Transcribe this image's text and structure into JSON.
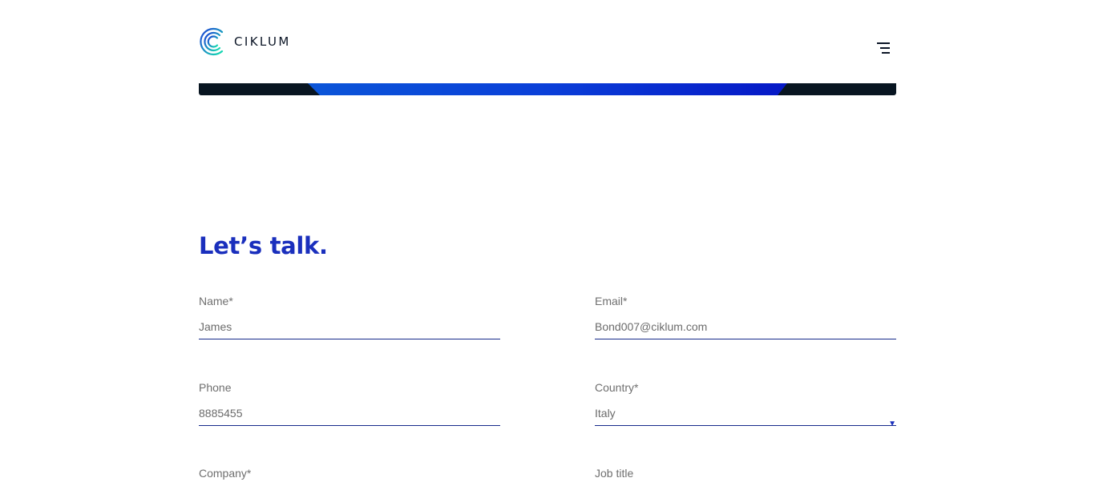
{
  "header": {
    "logo_text": "CIKLUM",
    "logo_icon": "ciklum-logo-icon",
    "menu_icon": "hamburger-menu-icon"
  },
  "contact": {
    "title": "Let’s talk.",
    "fields": {
      "name": {
        "label": "Name*",
        "value": "James"
      },
      "email": {
        "label": "Email*",
        "value": "Bond007@ciklum.com"
      },
      "phone": {
        "label": "Phone",
        "value": "8885455"
      },
      "country": {
        "label": "Country*",
        "value": "Italy",
        "arrow": "▼"
      },
      "company": {
        "label": "Company*"
      },
      "job": {
        "label": "Job title"
      }
    }
  },
  "colors": {
    "accent": "#1a2fbd",
    "text_dark": "#0b1526",
    "label_gray": "#6f6f6f",
    "underline": "#172a8a",
    "hero_dark": "#081521"
  }
}
